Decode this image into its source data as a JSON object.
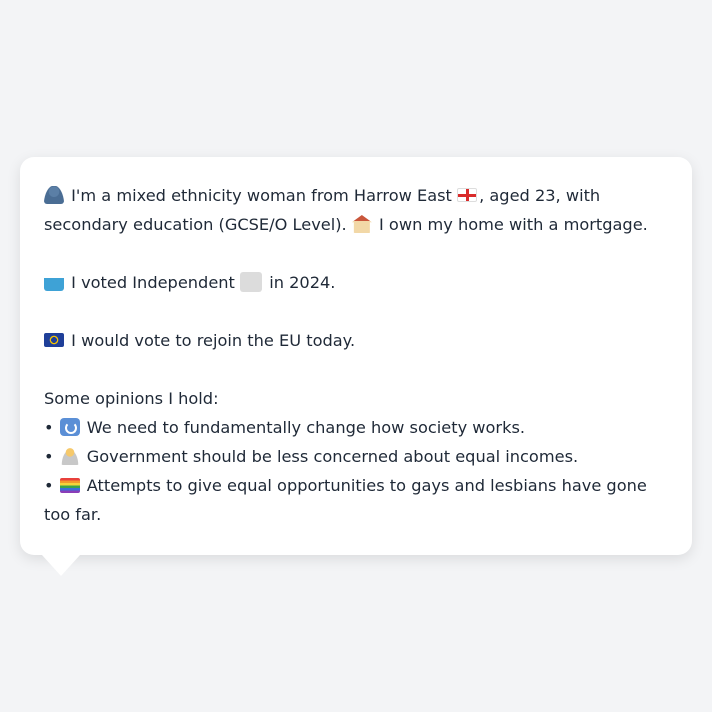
{
  "profile": {
    "intro_a": "I'm a mixed ethnicity woman from Harrow East",
    "intro_b": ", aged 23, with secondary education (GCSE/O Level).",
    "home": "I own my home with a mortgage.",
    "vote_a": "I voted Independent",
    "vote_b": "in 2024.",
    "eu": "I would vote to rejoin the EU today.",
    "opinions_heading": "Some opinions I hold:",
    "opinions": [
      {
        "icon": "refresh-icon",
        "text": "We need to fundamentally change how society works."
      },
      {
        "icon": "shrug-icon",
        "text": "Government should be less concerned about equal incomes."
      },
      {
        "icon": "rainbow-flag-icon",
        "text": "Attempts to give equal opportunities to gays and lesbians have gone too far."
      }
    ],
    "bullet": "•"
  },
  "colors": {
    "background": "#f3f4f6",
    "card": "#ffffff",
    "text": "#1f2937"
  }
}
